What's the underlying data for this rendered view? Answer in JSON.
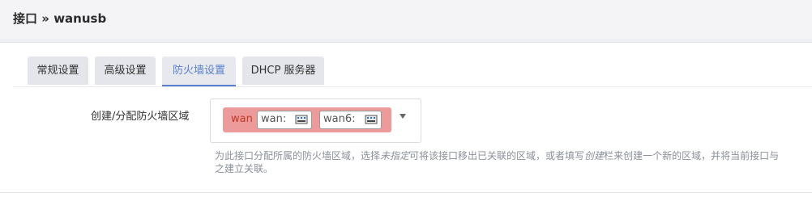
{
  "breadcrumb": {
    "section": "接口",
    "separator": "»",
    "current": "wanusb"
  },
  "tabs": [
    {
      "label": "常规设置",
      "active": false
    },
    {
      "label": "高级设置",
      "active": false
    },
    {
      "label": "防火墙设置",
      "active": true
    },
    {
      "label": "DHCP 服务器",
      "active": false
    }
  ],
  "firewall": {
    "field_label": "创建/分配防火墙区域",
    "zone": {
      "name": "wan",
      "color": "#ec9a9a",
      "networks": [
        {
          "label": "wan:",
          "icon": "ethernet-port-icon"
        },
        {
          "label": "wan6:",
          "icon": "ethernet-port-icon"
        }
      ]
    },
    "help": {
      "part1": "为此接口分配所属的防火墙区域，选择",
      "unspecified": "未指定",
      "part2": "可将该接口移出已关联的区域，或者填写",
      "create": "创建",
      "part3": "栏来创建一个新的区域，并将当前接口与之建立关联。"
    }
  },
  "colors": {
    "accent": "#5a7fcf",
    "zone_text": "#c0392b",
    "help_text": "#8a8f99"
  }
}
